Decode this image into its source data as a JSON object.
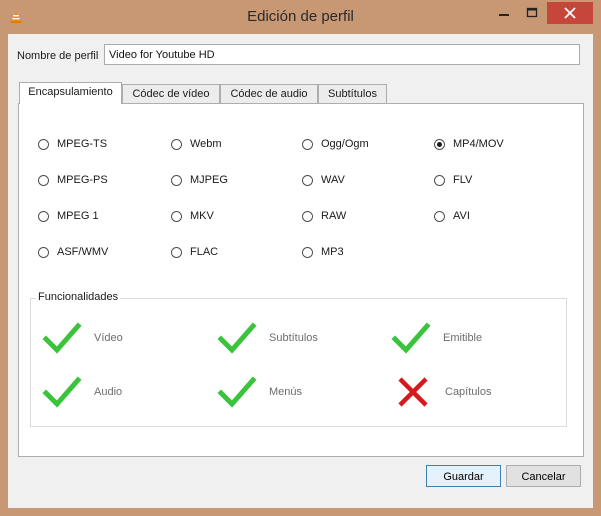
{
  "window": {
    "title": "Edición de perfil",
    "accent": "#c89774",
    "close_color": "#c7463c"
  },
  "profile": {
    "label": "Nombre de perfil",
    "value": "Video for Youtube HD"
  },
  "tabs": [
    {
      "label": "Encapsulamiento",
      "active": true
    },
    {
      "label": "Códec de vídeo",
      "active": false
    },
    {
      "label": "Códec de audio",
      "active": false
    },
    {
      "label": "Subtítulos",
      "active": false
    }
  ],
  "formats": [
    {
      "label": "MPEG-TS",
      "checked": false
    },
    {
      "label": "Webm",
      "checked": false
    },
    {
      "label": "Ogg/Ogm",
      "checked": false
    },
    {
      "label": "MP4/MOV",
      "checked": true
    },
    {
      "label": "MPEG-PS",
      "checked": false
    },
    {
      "label": "MJPEG",
      "checked": false
    },
    {
      "label": "WAV",
      "checked": false
    },
    {
      "label": "FLV",
      "checked": false
    },
    {
      "label": "MPEG 1",
      "checked": false
    },
    {
      "label": "MKV",
      "checked": false
    },
    {
      "label": "RAW",
      "checked": false
    },
    {
      "label": "AVI",
      "checked": false
    },
    {
      "label": "ASF/WMV",
      "checked": false
    },
    {
      "label": "FLAC",
      "checked": false
    },
    {
      "label": "MP3",
      "checked": false
    }
  ],
  "features": {
    "title": "Funcionalidades",
    "items": [
      {
        "label": "Vídeo",
        "supported": true,
        "icon": "check-icon"
      },
      {
        "label": "Subtítulos",
        "supported": true,
        "icon": "check-icon"
      },
      {
        "label": "Emitible",
        "supported": true,
        "icon": "check-icon"
      },
      {
        "label": "Audio",
        "supported": true,
        "icon": "check-icon"
      },
      {
        "label": "Menús",
        "supported": true,
        "icon": "check-icon"
      },
      {
        "label": "Capítulos",
        "supported": false,
        "icon": "cross-icon"
      }
    ],
    "colors": {
      "check": "#3cc33c",
      "cross": "#d7191c"
    }
  },
  "buttons": {
    "save": "Guardar",
    "cancel": "Cancelar"
  }
}
